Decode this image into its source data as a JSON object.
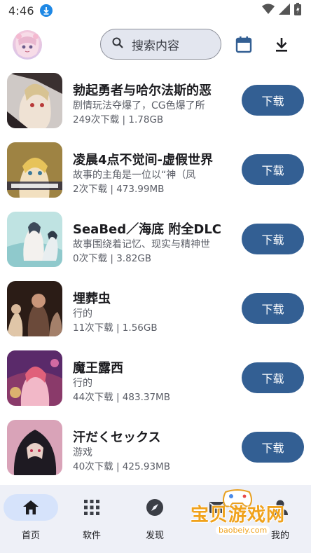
{
  "status_bar": {
    "time": "4:46",
    "download_indicator_icon": "download-arrow-icon",
    "icons": [
      "wifi-icon",
      "signal-icon",
      "battery-icon"
    ]
  },
  "top_bar": {
    "avatar_icon": "anime-avatar",
    "search_placeholder": "搜索内容",
    "calendar_icon": "calendar-icon",
    "download_icon": "download-icon"
  },
  "items": [
    {
      "title": "勃起勇者与哈尔法斯的恶",
      "desc": "剧情玩法夺爆了，CG色爆了所",
      "meta": "249次下载 | 1.78GB",
      "button": "下载"
    },
    {
      "title": "凌晨4点不觉间-虚假世界",
      "desc": "故事的主角是一位以“神（凤",
      "meta": "2次下载 | 473.99MB",
      "button": "下载"
    },
    {
      "title": "SeaBed／海底 附全DLC",
      "desc": "故事围绕着记忆、现实与精神世",
      "meta": "0次下载 | 3.82GB",
      "button": "下载"
    },
    {
      "title": "埋葬虫",
      "desc": "行的",
      "meta": "11次下载 | 1.56GB",
      "button": "下载"
    },
    {
      "title": "魔王露西",
      "desc": "行的",
      "meta": "44次下载 | 483.37MB",
      "button": "下载"
    },
    {
      "title": "汗だくセックス",
      "desc": "游戏",
      "meta": "40次下载 | 425.93MB",
      "button": "下载"
    }
  ],
  "nav": [
    {
      "label": "首页",
      "icon": "home-icon",
      "active": true
    },
    {
      "label": "软件",
      "icon": "grid-icon",
      "active": false
    },
    {
      "label": "发现",
      "icon": "compass-icon",
      "active": false
    },
    {
      "label": "",
      "icon": "mail-icon",
      "active": false
    },
    {
      "label": "我的",
      "icon": "person-icon",
      "active": false
    }
  ],
  "watermark": {
    "text": "宝贝游戏网",
    "url": "baobeiy.com"
  },
  "colors": {
    "accent": "#335f93",
    "search_bg": "#e3e6ef",
    "nav_bg": "#eef0f7",
    "nav_active_pill": "#d6e3fb",
    "watermark": "#f0a21c"
  }
}
